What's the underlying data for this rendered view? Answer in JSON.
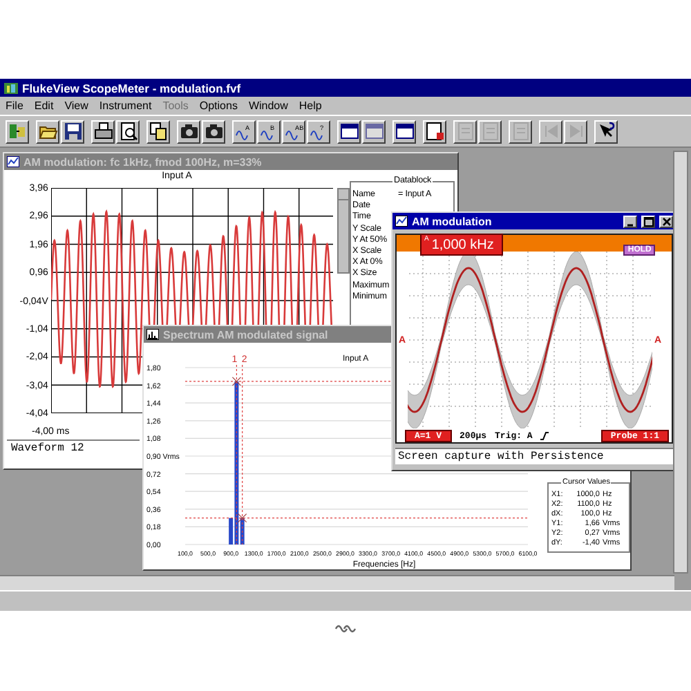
{
  "window": {
    "title": "FlukeView ScopeMeter - modulation.fvf"
  },
  "menu": [
    {
      "label": "File",
      "disabled": false
    },
    {
      "label": "Edit",
      "disabled": false
    },
    {
      "label": "View",
      "disabled": false
    },
    {
      "label": "Instrument",
      "disabled": false
    },
    {
      "label": "Tools",
      "disabled": true
    },
    {
      "label": "Options",
      "disabled": false
    },
    {
      "label": "Window",
      "disabled": false
    },
    {
      "label": "Help",
      "disabled": false
    }
  ],
  "toolbar": [
    [
      {
        "kind": "connect",
        "disabled": false
      }
    ],
    [
      {
        "kind": "open",
        "disabled": false
      },
      {
        "kind": "save",
        "disabled": false
      }
    ],
    [
      {
        "kind": "print",
        "disabled": false
      },
      {
        "kind": "preview",
        "disabled": false
      }
    ],
    [
      {
        "kind": "copy",
        "disabled": false
      }
    ],
    [
      {
        "kind": "camera",
        "disabled": false
      },
      {
        "kind": "camera",
        "disabled": false
      }
    ],
    [
      {
        "kind": "wave",
        "label": "A",
        "disabled": false
      },
      {
        "kind": "wave",
        "label": "B",
        "disabled": false
      },
      {
        "kind": "wave",
        "label": "AB",
        "disabled": false
      },
      {
        "kind": "wave",
        "label": "?",
        "disabled": false
      }
    ],
    [
      {
        "kind": "window",
        "disabled": false
      },
      {
        "kind": "window",
        "disabled": true
      }
    ],
    [
      {
        "kind": "window",
        "disabled": false
      }
    ],
    [
      {
        "kind": "record",
        "disabled": false
      }
    ],
    [
      {
        "kind": "document",
        "disabled": true
      },
      {
        "kind": "document",
        "disabled": true
      }
    ],
    [
      {
        "kind": "document",
        "disabled": true
      }
    ],
    [
      {
        "kind": "first",
        "disabled": true
      },
      {
        "kind": "last",
        "disabled": true
      }
    ],
    [
      {
        "kind": "help",
        "disabled": false
      }
    ]
  ],
  "waveform_window": {
    "title": "AM modulation: fc 1kHz, fmod 100Hz, m=33%",
    "active": false,
    "plot_title": "Input A",
    "y_labels": [
      "3,96",
      "2,96",
      "1,96",
      "0,96",
      "-0,04V",
      "-1,04",
      "-2,04",
      "-3,04",
      "-4,04"
    ],
    "x_label": "-4,00 ms",
    "caption": "Waveform 12",
    "datablock": {
      "title": "Datablock",
      "rows": [
        {
          "label": "Name",
          "value": "= Input A"
        },
        {
          "label": "Date"
        },
        {
          "label": "Time"
        },
        {
          "label": "Y Scale"
        },
        {
          "label": "Y At 50%"
        },
        {
          "label": "X Scale"
        },
        {
          "label": "X At 0%"
        },
        {
          "label": "X Size"
        },
        {
          "label": "Maximum"
        },
        {
          "label": "Minimum"
        }
      ]
    }
  },
  "spectrum_window": {
    "title": "Spectrum  AM modulated signal",
    "active": false,
    "chart_data": {
      "type": "bar",
      "title": "Input A",
      "xlabel": "Frequencies [Hz]",
      "x": [
        900,
        1000,
        1100
      ],
      "values": [
        0.27,
        1.66,
        0.27
      ],
      "xlim": [
        100,
        6100
      ],
      "ylim": [
        0,
        1.8
      ],
      "xticks": [
        {
          "value": 100,
          "label": "100,0"
        },
        {
          "value": 500,
          "label": "500,0"
        },
        {
          "value": 900,
          "label": "900,0"
        },
        {
          "value": 1300,
          "label": "1300,0"
        },
        {
          "value": 1700,
          "label": "1700,0"
        },
        {
          "value": 2100,
          "label": "2100,0"
        },
        {
          "value": 2500,
          "label": "2500,0"
        },
        {
          "value": 2900,
          "label": "2900,0"
        },
        {
          "value": 3300,
          "label": "3300,0"
        },
        {
          "value": 3700,
          "label": "3700,0"
        },
        {
          "value": 4100,
          "label": "4100,0"
        },
        {
          "value": 4500,
          "label": "4500,0"
        },
        {
          "value": 4900,
          "label": "4900,0"
        },
        {
          "value": 5300,
          "label": "5300,0"
        },
        {
          "value": 5700,
          "label": "5700,0"
        },
        {
          "value": 6100,
          "label": "6100,0"
        }
      ],
      "yticks": [
        {
          "value": 1.8,
          "label": "1,80"
        },
        {
          "value": 1.62,
          "label": "1,62"
        },
        {
          "value": 1.44,
          "label": "1,44"
        },
        {
          "value": 1.26,
          "label": "1,26"
        },
        {
          "value": 1.08,
          "label": "1,08"
        },
        {
          "value": 0.9,
          "label": "0,90 Vrms"
        },
        {
          "value": 0.72,
          "label": "0,72"
        },
        {
          "value": 0.54,
          "label": "0,54"
        },
        {
          "value": 0.36,
          "label": "0,36"
        },
        {
          "value": 0.18,
          "label": "0,18"
        },
        {
          "value": 0,
          "label": "0,00"
        }
      ],
      "grid": true,
      "ref_lines": [
        {
          "axis": "x",
          "value": 1000
        },
        {
          "axis": "x",
          "value": 1100
        },
        {
          "axis": "y",
          "value": 1.66
        },
        {
          "axis": "y",
          "value": 0.27
        }
      ],
      "annotations": [
        {
          "x": 1000,
          "text": "1"
        },
        {
          "x": 1100,
          "text": "2"
        }
      ]
    },
    "cursor_values": {
      "title": "Cursor Values",
      "rows": [
        {
          "label": "X1:",
          "value": "1000,0",
          "unit": "Hz"
        },
        {
          "label": "X2:",
          "value": "1100,0",
          "unit": "Hz"
        },
        {
          "label": "dX:",
          "value": "100,0",
          "unit": "Hz"
        },
        {
          "label": "Y1:",
          "value": "1,66",
          "unit": "Vrms"
        },
        {
          "label": "Y2:",
          "value": "0,27",
          "unit": "Vrms"
        },
        {
          "label": "dY:",
          "value": "-1,40",
          "unit": "Vrms"
        }
      ]
    }
  },
  "capture_window": {
    "title": "AM modulation",
    "active": true,
    "channel_mark": "A",
    "frequency": "1,000 kHz",
    "hold": "HOLD",
    "trace_marks": [
      "A",
      "A"
    ],
    "range": "A=1 V",
    "timebase": "200µs",
    "trigger": "Trig: A",
    "probe": "Probe 1:1",
    "caption": "Screen capture with Persistence"
  }
}
